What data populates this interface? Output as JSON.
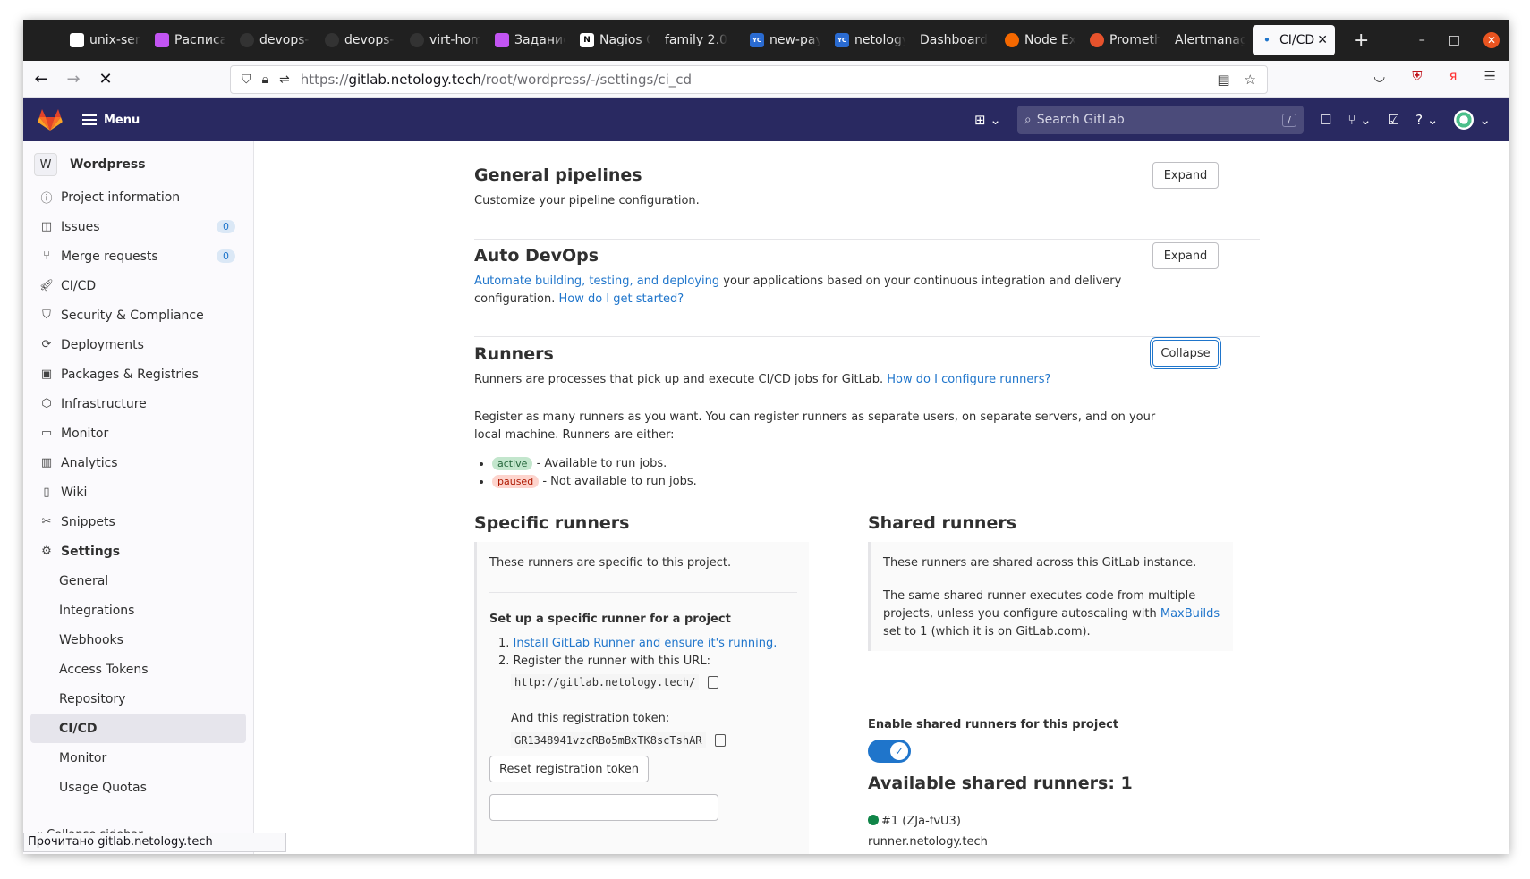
{
  "browser": {
    "tabs": [
      {
        "label": "unix-server",
        "icon": "notepad-icon",
        "color": "#ffffff"
      },
      {
        "label": "Расписание",
        "icon": "app-icon",
        "color": "#c254f2"
      },
      {
        "label": "devops-",
        "icon": "github-icon",
        "color": "#444444"
      },
      {
        "label": "devops-",
        "icon": "github-icon",
        "color": "#444444"
      },
      {
        "label": "virt-homework",
        "icon": "github-icon",
        "color": "#444444"
      },
      {
        "label": "Задание",
        "icon": "app-icon",
        "color": "#c254f2"
      },
      {
        "label": "Nagios Core",
        "icon": "notion-icon",
        "color": "#ffffff"
      },
      {
        "label": "family 2.0",
        "icon": "",
        "color": ""
      },
      {
        "label": "new-pay",
        "icon": "yc-icon",
        "color": "#2a6bd1"
      },
      {
        "label": "netology",
        "icon": "yc-icon",
        "color": "#2a6bd1"
      },
      {
        "label": "Dashboard",
        "icon": "",
        "color": ""
      },
      {
        "label": "Node Exporter",
        "icon": "grafana-icon",
        "color": "#f46800"
      },
      {
        "label": "Prometheus",
        "icon": "prometheus-icon",
        "color": "#e6522c"
      },
      {
        "label": "Alertmanager",
        "icon": "",
        "color": ""
      }
    ],
    "active_tab": {
      "label": "CI/CD",
      "close": "✕"
    },
    "new_tab": "+",
    "url": {
      "prefix": "https://",
      "host": "gitlab.netology.tech",
      "path": "/root/wordpress/-/settings/ci_cd"
    },
    "status_bar": "Прочитано gitlab.netology.tech",
    "window_controls": {
      "minimize": "–",
      "maximize": "□",
      "close": "✕"
    }
  },
  "gitlab_header": {
    "menu_label": "Menu",
    "search_placeholder": "Search GitLab",
    "search_shortcut": "/"
  },
  "sidebar": {
    "project_initial": "W",
    "project_name": "Wordpress",
    "items": [
      {
        "label": "Project information",
        "icon": "info-icon"
      },
      {
        "label": "Issues",
        "icon": "issues-icon",
        "badge": "0"
      },
      {
        "label": "Merge requests",
        "icon": "merge-request-icon",
        "badge": "0"
      },
      {
        "label": "CI/CD",
        "icon": "rocket-icon"
      },
      {
        "label": "Security & Compliance",
        "icon": "shield-icon"
      },
      {
        "label": "Deployments",
        "icon": "deployments-icon"
      },
      {
        "label": "Packages & Registries",
        "icon": "package-icon"
      },
      {
        "label": "Infrastructure",
        "icon": "infrastructure-icon"
      },
      {
        "label": "Monitor",
        "icon": "monitor-icon"
      },
      {
        "label": "Analytics",
        "icon": "analytics-icon"
      },
      {
        "label": "Wiki",
        "icon": "book-icon"
      },
      {
        "label": "Snippets",
        "icon": "scissors-icon"
      },
      {
        "label": "Settings",
        "icon": "gear-icon"
      }
    ],
    "settings_sub": [
      "General",
      "Integrations",
      "Webhooks",
      "Access Tokens",
      "Repository",
      "CI/CD",
      "Monitor",
      "Usage Quotas"
    ],
    "active_sub": "CI/CD",
    "collapse_label": "Collapse sidebar"
  },
  "main": {
    "general_pipelines": {
      "title": "General pipelines",
      "desc": "Customize your pipeline configuration.",
      "button": "Expand"
    },
    "auto_devops": {
      "title": "Auto DevOps",
      "link1": "Automate building, testing, and deploying",
      "text1": " your applications based on your continuous integration and delivery configuration. ",
      "link2": "How do I get started?",
      "button": "Expand"
    },
    "runners": {
      "title": "Runners",
      "button": "Collapse",
      "desc": "Runners are processes that pick up and execute CI/CD jobs for GitLab. ",
      "desc_link": "How do I configure runners?",
      "register_text": "Register as many runners as you want. You can register runners as separate users, on separate servers, and on your local machine. Runners are either:",
      "active_pill": "active",
      "active_text": " - Available to run jobs.",
      "paused_pill": "paused",
      "paused_text": " - Not available to run jobs."
    },
    "specific": {
      "title": "Specific runners",
      "intro": "These runners are specific to this project.",
      "setup_title": "Set up a specific runner for a project",
      "step1_link": "Install GitLab Runner and ensure it's running.",
      "step2": "Register the runner with this URL:",
      "url": "http://gitlab.netology.tech/",
      "token_label": "And this registration token:",
      "token": "GR1348941vzcRBo5mBxTK8scTshAR",
      "reset_button": "Reset registration token"
    },
    "shared": {
      "title": "Shared runners",
      "intro": "These runners are shared across this GitLab instance.",
      "text": "The same shared runner executes code from multiple projects, unless you configure autoscaling with ",
      "link": "MaxBuilds",
      "text2": " set to 1 (which it is on GitLab.com).",
      "enable_label": "Enable shared runners for this project",
      "toggle_on": true,
      "available_title": "Available shared runners: 1",
      "runner_name": "#1 (ZJa-fvU3)",
      "runner_host": "runner.netology.tech"
    }
  }
}
